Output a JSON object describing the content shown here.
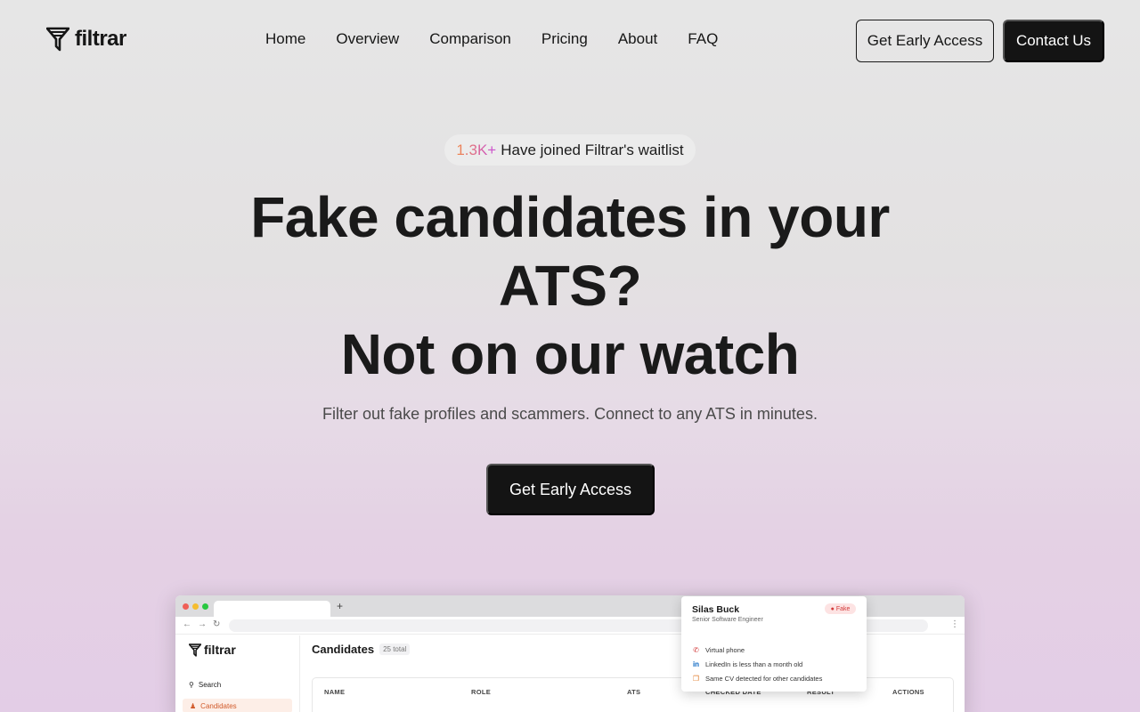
{
  "brand": {
    "name": "filtrar"
  },
  "nav": {
    "items": [
      {
        "label": "Home"
      },
      {
        "label": "Overview"
      },
      {
        "label": "Comparison"
      },
      {
        "label": "Pricing"
      },
      {
        "label": "About"
      },
      {
        "label": "FAQ"
      }
    ],
    "early_access_label": "Get Early Access",
    "contact_label": "Contact Us"
  },
  "hero": {
    "badge_count": "1.3K+",
    "badge_text": "Have joined Filtrar's waitlist",
    "headline_line1": "Fake candidates in your",
    "headline_line2": "ATS?",
    "headline_line3": "Not on our watch",
    "subtitle": "Filter out fake profiles and scammers. Connect to any ATS in minutes.",
    "cta_label": "Get Early Access"
  },
  "mockup": {
    "browser_tab_plus": "+",
    "sidebar": {
      "logo": "filtrar",
      "search_label": "Search",
      "candidates_label": "Candidates"
    },
    "page_title": "Candidates",
    "total_badge": "25 total",
    "table_headers": [
      "NAME",
      "ROLE",
      "ATS",
      "CHECKED DATE",
      "RESULT",
      "ACTIONS"
    ],
    "popup": {
      "name": "Silas Buck",
      "role": "Senior Software Engineer",
      "badge": "Fake",
      "flags": [
        {
          "icon": "phone-off-icon",
          "text": "Virtual phone"
        },
        {
          "icon": "linkedin-icon",
          "text": "LinkedIn is less than a month old"
        },
        {
          "icon": "copy-icon",
          "text": "Same CV detected for other candidates"
        }
      ]
    }
  },
  "colors": {
    "dark": "#141414",
    "badge_gradient_start": "#f08a4b",
    "badge_gradient_end": "#c84bd8",
    "accent_orange": "#d15a2a",
    "fake_red": "#d23b3b"
  }
}
